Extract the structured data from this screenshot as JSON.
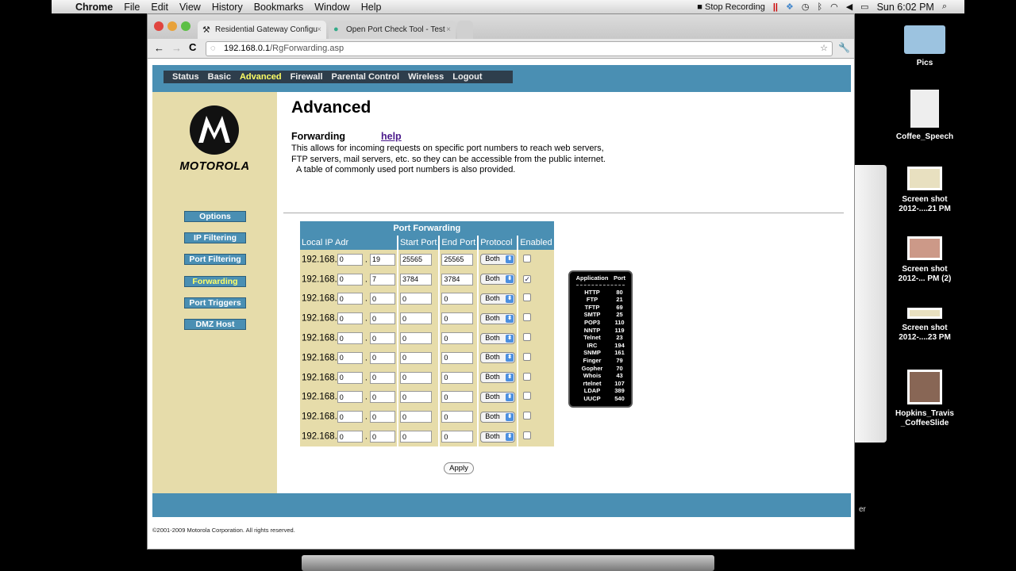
{
  "menubar": {
    "app": "Chrome",
    "items": [
      "File",
      "Edit",
      "View",
      "History",
      "Bookmarks",
      "Window",
      "Help"
    ],
    "recording": "Stop Recording",
    "clock": "Sun 6:02 PM"
  },
  "browser": {
    "tabs": [
      {
        "title": "Residential Gateway Configu"
      },
      {
        "title": "Open Port Check Tool - Test"
      }
    ],
    "url_host": "192.168.0.1",
    "url_path": "/RgForwarding.asp"
  },
  "nav": {
    "items": [
      "Status",
      "Basic",
      "Advanced",
      "Firewall",
      "Parental Control",
      "Wireless",
      "Logout"
    ],
    "active": "Advanced",
    "active_color": "#ffff66"
  },
  "brand": {
    "name": "MOTOROLA"
  },
  "sidebar": {
    "items": [
      "Options",
      "IP Filtering",
      "Port Filtering",
      "Forwarding",
      "Port Triggers",
      "DMZ Host"
    ],
    "active": "Forwarding"
  },
  "page": {
    "title": "Advanced",
    "section": "Forwarding",
    "help": "help",
    "desc1": "This allows for incoming requests on specific port numbers to reach  web servers,",
    "desc2": "FTP servers, mail servers, etc. so they can be accessible from the public internet.",
    "desc3": "A table of commonly used port numbers is also provided."
  },
  "table": {
    "title": "Port Forwarding",
    "headers": [
      "Local IP Adr",
      "Start Port",
      "End Port",
      "Protocol",
      "Enabled"
    ],
    "prefix": "192.168.",
    "rows": [
      {
        "o3": "0",
        "o4": "19",
        "start": "25565",
        "end": "25565",
        "protocol": "Both",
        "enabled": false
      },
      {
        "o3": "0",
        "o4": "7",
        "start": "3784",
        "end": "3784",
        "protocol": "Both",
        "enabled": true
      },
      {
        "o3": "0",
        "o4": "0",
        "start": "0",
        "end": "0",
        "protocol": "Both",
        "enabled": false
      },
      {
        "o3": "0",
        "o4": "0",
        "start": "0",
        "end": "0",
        "protocol": "Both",
        "enabled": false
      },
      {
        "o3": "0",
        "o4": "0",
        "start": "0",
        "end": "0",
        "protocol": "Both",
        "enabled": false
      },
      {
        "o3": "0",
        "o4": "0",
        "start": "0",
        "end": "0",
        "protocol": "Both",
        "enabled": false
      },
      {
        "o3": "0",
        "o4": "0",
        "start": "0",
        "end": "0",
        "protocol": "Both",
        "enabled": false
      },
      {
        "o3": "0",
        "o4": "0",
        "start": "0",
        "end": "0",
        "protocol": "Both",
        "enabled": false
      },
      {
        "o3": "0",
        "o4": "0",
        "start": "0",
        "end": "0",
        "protocol": "Both",
        "enabled": false
      },
      {
        "o3": "0",
        "o4": "0",
        "start": "0",
        "end": "0",
        "protocol": "Both",
        "enabled": false
      }
    ]
  },
  "apply": "Apply",
  "ports": {
    "headers": [
      "Application",
      "Port"
    ],
    "rows": [
      [
        "HTTP",
        "80"
      ],
      [
        "FTP",
        "21"
      ],
      [
        "TFTP",
        "69"
      ],
      [
        "SMTP",
        "25"
      ],
      [
        "POP3",
        "110"
      ],
      [
        "NNTP",
        "119"
      ],
      [
        "Telnet",
        "23"
      ],
      [
        "IRC",
        "194"
      ],
      [
        "SNMP",
        "161"
      ],
      [
        "Finger",
        "79"
      ],
      [
        "Gopher",
        "70"
      ],
      [
        "Whois",
        "43"
      ],
      [
        "rtelnet",
        "107"
      ],
      [
        "LDAP",
        "389"
      ],
      [
        "UUCP",
        "540"
      ]
    ]
  },
  "footer": "©2001-2009 Motorola Corporation. All rights reserved.",
  "desktop": [
    {
      "l1": "Pics"
    },
    {
      "l1": "Coffee_Speech"
    },
    {
      "l1": "Screen shot",
      "l2": "2012-....21 PM"
    },
    {
      "l1": "Screen shot",
      "l2": "2012-... PM (2)"
    },
    {
      "l1": "Screen shot",
      "l2": "2012-....23 PM"
    },
    {
      "l1": "Hopkins_Travis",
      "l2": "_CoffeeSlide"
    }
  ],
  "finder_partial": "er"
}
